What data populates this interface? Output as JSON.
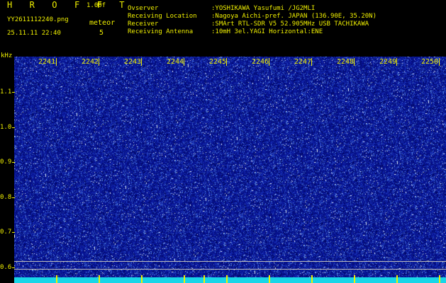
{
  "header": {
    "title": "H R O F F T",
    "version": "1.00f",
    "filename": "YY2611112240.png",
    "datetime": "25.11.11 22:40",
    "meteor_label": "meteor",
    "meteor_count": "5"
  },
  "info": [
    {
      "key": "Ovserver",
      "value": ":YOSHIKAWA Yasufumi /JG2MLI"
    },
    {
      "key": "Receiving Location",
      "value": ":Nagoya Aichi-pref. JAPAN (136.90E, 35.20N)"
    },
    {
      "key": "Receiver",
      "value": ":SMArt RTL-SDR V5 52.905MHz USB TACHIKAWA"
    },
    {
      "key": "Receiving Antenna",
      "value": ":10mH 3el.YAGI Horizontal:ENE"
    }
  ],
  "axis": {
    "y_unit": "kHz",
    "y_ticks": [
      "1.1",
      "1.0",
      "0.9",
      "0.8",
      "0.7",
      "0.6"
    ],
    "x_ticks": [
      "2241",
      "2242",
      "2243",
      "2244",
      "2245",
      "2246",
      "2247",
      "2248",
      "2249",
      "2250"
    ]
  },
  "colors": {
    "text": "#f0f000",
    "background": "#000000",
    "waterfall_base": "#0a1a9c",
    "noise_floor": "#18d6e8",
    "marker_line": "#bdbdbd"
  }
}
